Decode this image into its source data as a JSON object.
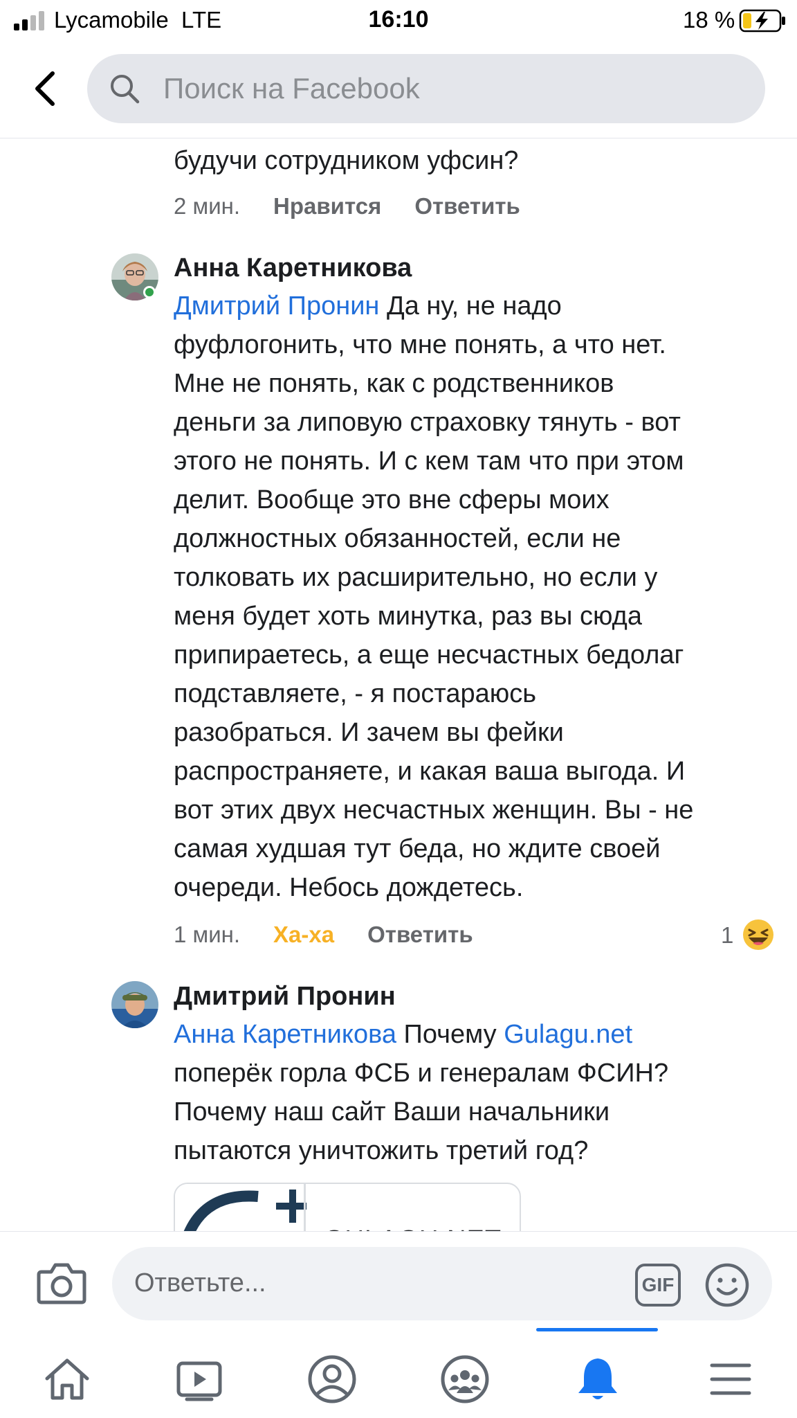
{
  "status_bar": {
    "carrier": "Lycamobile",
    "network": "LTE",
    "time": "16:10",
    "battery": "18 %"
  },
  "search": {
    "placeholder": "Поиск на Facebook"
  },
  "comments": [
    {
      "text_tail": "будучи сотрудником уфсин?",
      "time": "2 мин.",
      "like_label": "Нравится",
      "reply_label": "Ответить"
    },
    {
      "author": "Анна Каретникова",
      "mention": "Дмитрий Пронин",
      "lines": [
        " Да ну, не надо",
        "фуфлогонить, что мне понять, а что нет.",
        "Мне не понять, как с родственников",
        "деньги за липовую страховку тянуть - вот",
        "этого не понять. И с кем там что при этом",
        "делит. Вообще это вне сферы моих",
        "должностных обязанностей, если не",
        "толковать их расширительно, но если у",
        "меня будет хоть минутка, раз вы сюда",
        "припираетесь, а еще несчастных бедолаг",
        "подставляете, - я постараюсь",
        "разобраться. И зачем вы фейки",
        "распространяете, и какая ваша выгода. И",
        "вот этих двух несчастных женщин. Вы - не",
        "самая худшая тут беда, но ждите своей",
        "очереди. Небось дождетесь."
      ],
      "time": "1 мин.",
      "reaction_label": "Ха-ха",
      "reply_label": "Ответить",
      "reaction_count": "1",
      "online": true
    },
    {
      "author": "Дмитрий Пронин",
      "mention": "Анна Каретникова",
      "line1_text": " Почему ",
      "link": "Gulagu.net",
      "lines": [
        "поперёк горла ФСБ и генералам ФСИН?",
        "Почему наш сайт Ваши начальники",
        "пытаются уничтожить третий год?"
      ],
      "card_domain": "GULAGU.NET"
    }
  ],
  "reply_bar": {
    "placeholder": "Ответьте...",
    "gif_label": "GIF"
  },
  "nav": {
    "active": "notifications"
  },
  "colors": {
    "mention": "#216fdb",
    "haha": "#f7b125",
    "accent": "#1877f2",
    "search_bg": "#e4e6eb"
  }
}
